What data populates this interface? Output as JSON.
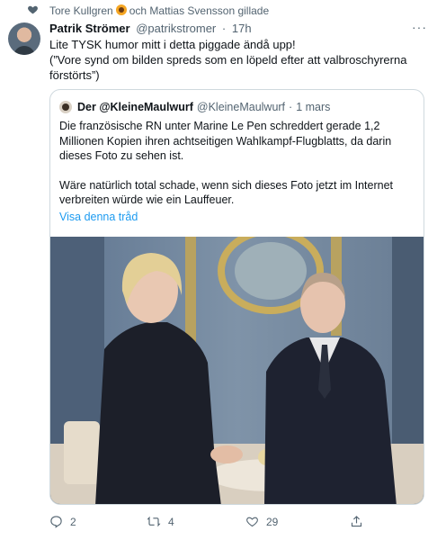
{
  "social_context": {
    "text_before": "Tore Kullgren",
    "text_after": "och Mattias Svensson gillade",
    "icon": "heart-icon"
  },
  "tweet": {
    "name": "Patrik Strömer",
    "handle": "@patrikstromer",
    "separator": "·",
    "time": "17h",
    "line1": "Lite TYSK humor mitt i detta piggade ändå upp!",
    "line2": "(”Vore synd om bilden spreds som en löpeld efter att valbroschyrerna förstörts”)"
  },
  "quote": {
    "name": "Der @KleineMaulwurf",
    "handle": "@KleineMaulwurf",
    "separator": "·",
    "time": "1 mars",
    "para1": "Die französische RN unter Marine Le Pen schreddert gerade 1,2 Millionen Kopien ihren achtseitigen Wahlkampf-Flugblatts, da darin dieses Foto zu sehen ist.",
    "para2": "Wäre natürlich total schade, wenn sich dieses Foto jetzt im Internet verbreiten würde wie ein Lauffeuer.",
    "thread_link": "Visa denna tråd"
  },
  "actions": {
    "replies": "2",
    "retweets": "4",
    "likes": "29"
  },
  "colors": {
    "link": "#1d9bf0",
    "muted": "#536471",
    "border": "#cfd9de"
  }
}
